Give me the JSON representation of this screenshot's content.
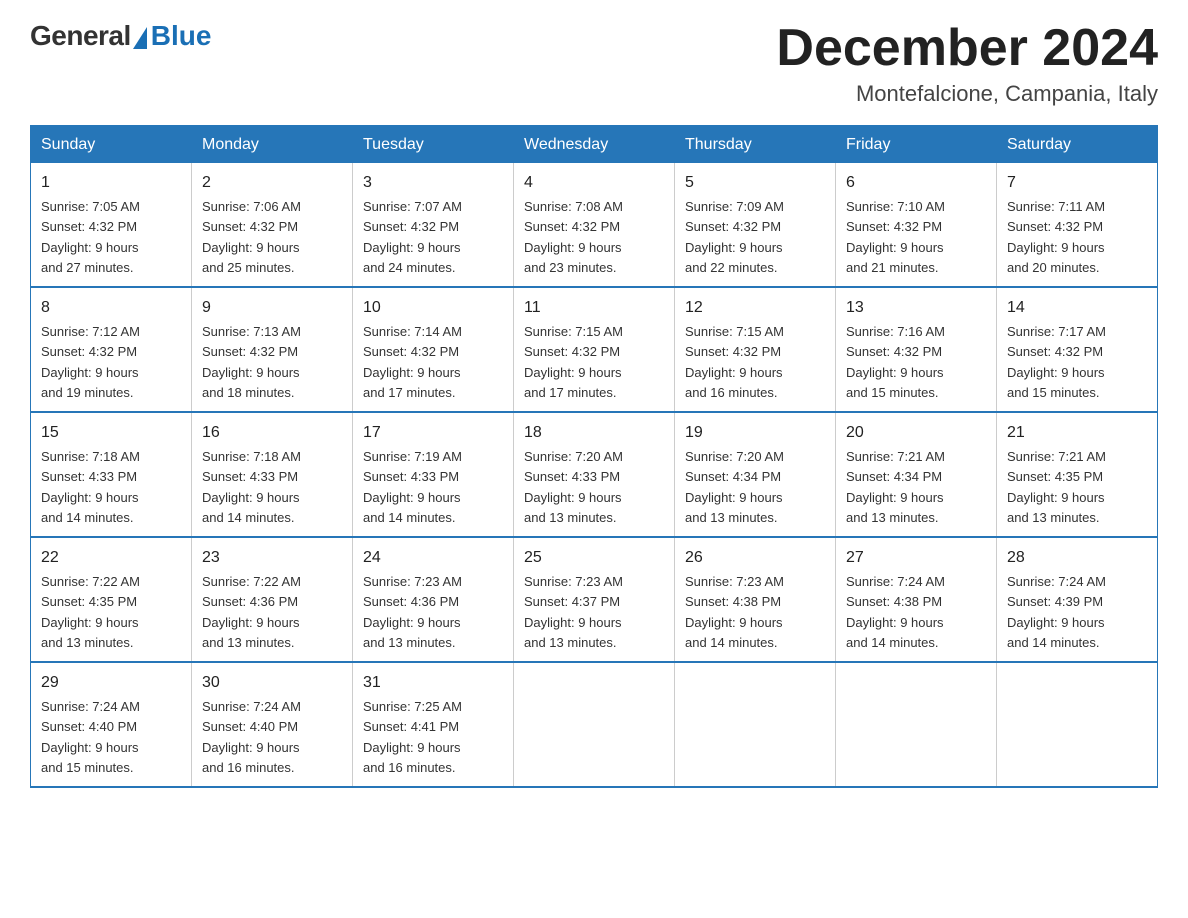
{
  "logo": {
    "general": "General",
    "blue": "Blue"
  },
  "title": "December 2024",
  "location": "Montefalcione, Campania, Italy",
  "days_of_week": [
    "Sunday",
    "Monday",
    "Tuesday",
    "Wednesday",
    "Thursday",
    "Friday",
    "Saturday"
  ],
  "weeks": [
    [
      {
        "day": "1",
        "sunrise": "7:05 AM",
        "sunset": "4:32 PM",
        "daylight": "9 hours and 27 minutes."
      },
      {
        "day": "2",
        "sunrise": "7:06 AM",
        "sunset": "4:32 PM",
        "daylight": "9 hours and 25 minutes."
      },
      {
        "day": "3",
        "sunrise": "7:07 AM",
        "sunset": "4:32 PM",
        "daylight": "9 hours and 24 minutes."
      },
      {
        "day": "4",
        "sunrise": "7:08 AM",
        "sunset": "4:32 PM",
        "daylight": "9 hours and 23 minutes."
      },
      {
        "day": "5",
        "sunrise": "7:09 AM",
        "sunset": "4:32 PM",
        "daylight": "9 hours and 22 minutes."
      },
      {
        "day": "6",
        "sunrise": "7:10 AM",
        "sunset": "4:32 PM",
        "daylight": "9 hours and 21 minutes."
      },
      {
        "day": "7",
        "sunrise": "7:11 AM",
        "sunset": "4:32 PM",
        "daylight": "9 hours and 20 minutes."
      }
    ],
    [
      {
        "day": "8",
        "sunrise": "7:12 AM",
        "sunset": "4:32 PM",
        "daylight": "9 hours and 19 minutes."
      },
      {
        "day": "9",
        "sunrise": "7:13 AM",
        "sunset": "4:32 PM",
        "daylight": "9 hours and 18 minutes."
      },
      {
        "day": "10",
        "sunrise": "7:14 AM",
        "sunset": "4:32 PM",
        "daylight": "9 hours and 17 minutes."
      },
      {
        "day": "11",
        "sunrise": "7:15 AM",
        "sunset": "4:32 PM",
        "daylight": "9 hours and 17 minutes."
      },
      {
        "day": "12",
        "sunrise": "7:15 AM",
        "sunset": "4:32 PM",
        "daylight": "9 hours and 16 minutes."
      },
      {
        "day": "13",
        "sunrise": "7:16 AM",
        "sunset": "4:32 PM",
        "daylight": "9 hours and 15 minutes."
      },
      {
        "day": "14",
        "sunrise": "7:17 AM",
        "sunset": "4:32 PM",
        "daylight": "9 hours and 15 minutes."
      }
    ],
    [
      {
        "day": "15",
        "sunrise": "7:18 AM",
        "sunset": "4:33 PM",
        "daylight": "9 hours and 14 minutes."
      },
      {
        "day": "16",
        "sunrise": "7:18 AM",
        "sunset": "4:33 PM",
        "daylight": "9 hours and 14 minutes."
      },
      {
        "day": "17",
        "sunrise": "7:19 AM",
        "sunset": "4:33 PM",
        "daylight": "9 hours and 14 minutes."
      },
      {
        "day": "18",
        "sunrise": "7:20 AM",
        "sunset": "4:33 PM",
        "daylight": "9 hours and 13 minutes."
      },
      {
        "day": "19",
        "sunrise": "7:20 AM",
        "sunset": "4:34 PM",
        "daylight": "9 hours and 13 minutes."
      },
      {
        "day": "20",
        "sunrise": "7:21 AM",
        "sunset": "4:34 PM",
        "daylight": "9 hours and 13 minutes."
      },
      {
        "day": "21",
        "sunrise": "7:21 AM",
        "sunset": "4:35 PM",
        "daylight": "9 hours and 13 minutes."
      }
    ],
    [
      {
        "day": "22",
        "sunrise": "7:22 AM",
        "sunset": "4:35 PM",
        "daylight": "9 hours and 13 minutes."
      },
      {
        "day": "23",
        "sunrise": "7:22 AM",
        "sunset": "4:36 PM",
        "daylight": "9 hours and 13 minutes."
      },
      {
        "day": "24",
        "sunrise": "7:23 AM",
        "sunset": "4:36 PM",
        "daylight": "9 hours and 13 minutes."
      },
      {
        "day": "25",
        "sunrise": "7:23 AM",
        "sunset": "4:37 PM",
        "daylight": "9 hours and 13 minutes."
      },
      {
        "day": "26",
        "sunrise": "7:23 AM",
        "sunset": "4:38 PM",
        "daylight": "9 hours and 14 minutes."
      },
      {
        "day": "27",
        "sunrise": "7:24 AM",
        "sunset": "4:38 PM",
        "daylight": "9 hours and 14 minutes."
      },
      {
        "day": "28",
        "sunrise": "7:24 AM",
        "sunset": "4:39 PM",
        "daylight": "9 hours and 14 minutes."
      }
    ],
    [
      {
        "day": "29",
        "sunrise": "7:24 AM",
        "sunset": "4:40 PM",
        "daylight": "9 hours and 15 minutes."
      },
      {
        "day": "30",
        "sunrise": "7:24 AM",
        "sunset": "4:40 PM",
        "daylight": "9 hours and 16 minutes."
      },
      {
        "day": "31",
        "sunrise": "7:25 AM",
        "sunset": "4:41 PM",
        "daylight": "9 hours and 16 minutes."
      },
      null,
      null,
      null,
      null
    ]
  ],
  "labels": {
    "sunrise": "Sunrise:",
    "sunset": "Sunset:",
    "daylight": "Daylight:"
  }
}
